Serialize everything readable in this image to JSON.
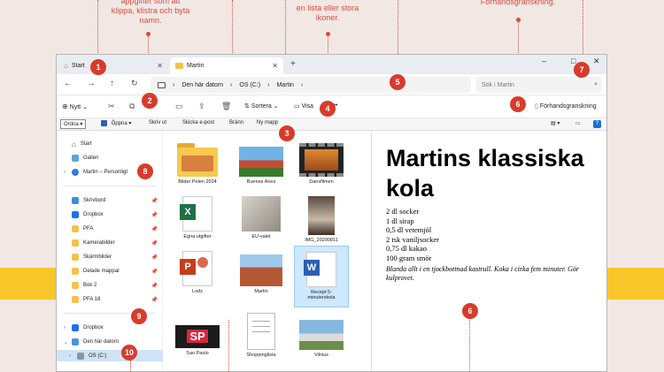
{
  "captions": {
    "c1": "appgifter som att klippa, klistra och byta namn.",
    "c4": "en lista eller stora ikoner.",
    "c6": "Förhandsgranskning."
  },
  "tabs": [
    {
      "label": "Start"
    },
    {
      "label": "Martin"
    }
  ],
  "window_controls": {
    "minimize": "–",
    "maximize": "□",
    "close": "✕"
  },
  "address": {
    "crumbs": [
      "Den här datorn",
      "OS (C:)",
      "Martin"
    ],
    "search_placeholder": "Sök i Martin"
  },
  "command_bar": {
    "new": "Nytt",
    "sort": "Sortera",
    "view": "Visa",
    "more": "•••",
    "preview": "Förhandsgranskning"
  },
  "menu_bar": {
    "ordna": "Ordna ▾",
    "open": "Öppna ▾",
    "print": "Skriv ut",
    "email": "Skicka e-post",
    "burn": "Bränn",
    "newfolder": "Ny mapp",
    "help": "?"
  },
  "sidebar": {
    "items": [
      {
        "label": "Start"
      },
      {
        "label": "Galleri"
      },
      {
        "label": "Martin – Personligt"
      },
      {
        "label": "Skrivbord"
      },
      {
        "label": "Dropbox"
      },
      {
        "label": "PFA"
      },
      {
        "label": "Kamerabilder"
      },
      {
        "label": "Skärmbilder"
      },
      {
        "label": "Delade mappar"
      },
      {
        "label": "Bok 2"
      },
      {
        "label": "PFA 18"
      },
      {
        "label": "Dropbox"
      },
      {
        "label": "Den här datorn"
      },
      {
        "label": "OS (C:)"
      }
    ]
  },
  "files": [
    {
      "name": "Bilder Polen 2024"
    },
    {
      "name": "Buenos Aires"
    },
    {
      "name": "Dansfilmen"
    },
    {
      "name": "Egna utgifter"
    },
    {
      "name": "EU-valet"
    },
    {
      "name": "IMG_20200811"
    },
    {
      "name": "Lodz"
    },
    {
      "name": "Martin"
    },
    {
      "name": "Recept 5-minuterskola"
    },
    {
      "name": "Sao Paulo"
    },
    {
      "name": "Shoppinglista"
    },
    {
      "name": "Vilnius"
    }
  ],
  "thumb_text": {
    "sp": "SP"
  },
  "preview_doc": {
    "title": "Martins klassiska kola",
    "lines": [
      "2 dl socker",
      "1 dl sirap",
      "0,5 dl vetemjöl",
      "2 tsk vaniljsocker",
      "0,75 dl kakao",
      "100 gram smör"
    ],
    "note": "Blanda allt i en tjockbottnad kastrull. Koka i cirka fem minuter. Gör kulprovet."
  },
  "badges": [
    "1",
    "2",
    "3",
    "4",
    "5",
    "6",
    "7",
    "8",
    "9",
    "10",
    "6"
  ],
  "colors": {
    "accent": "#d83b2c",
    "band": "#f7c72a",
    "selection": "#cde8ff"
  }
}
